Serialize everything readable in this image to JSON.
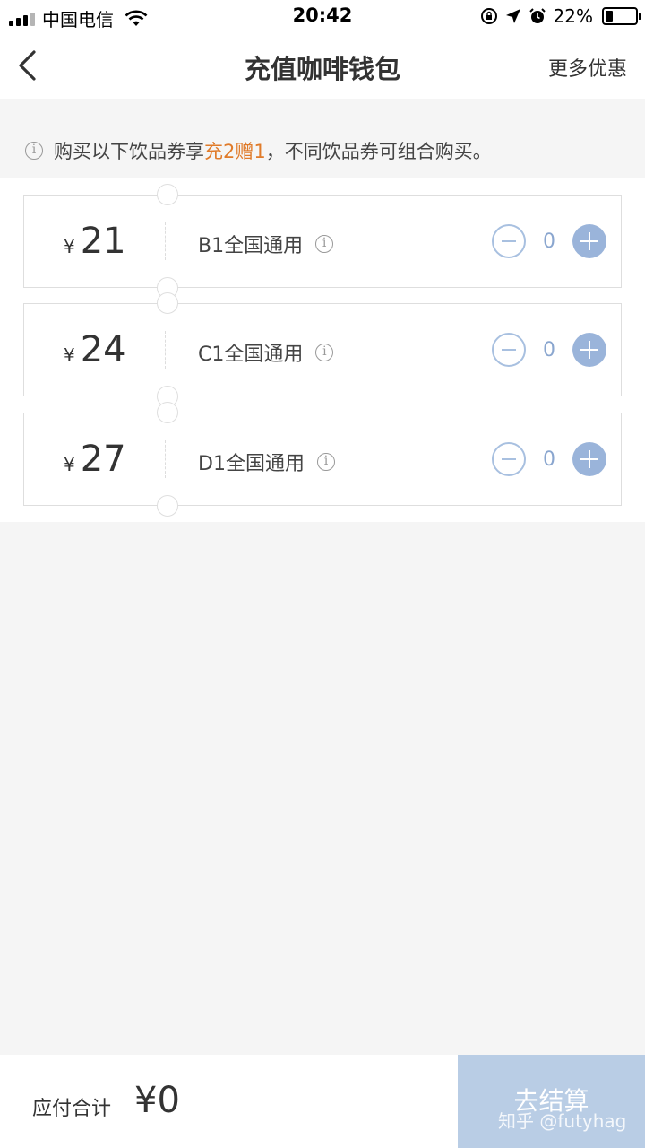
{
  "status_bar": {
    "carrier": "中国电信",
    "time": "20:42",
    "battery": "22%"
  },
  "nav": {
    "title": "充值咖啡钱包",
    "more": "更多优惠"
  },
  "notice": {
    "prefix": "购买以下饮品券享",
    "highlight": "充2赠1",
    "suffix": "，不同饮品券可组合购买。"
  },
  "coupons": [
    {
      "currency": "¥",
      "price": "21",
      "name": "B1全国通用",
      "count": "0"
    },
    {
      "currency": "¥",
      "price": "24",
      "name": "C1全国通用",
      "count": "0"
    },
    {
      "currency": "¥",
      "price": "27",
      "name": "D1全国通用",
      "count": "0"
    }
  ],
  "footer": {
    "total_label": "应付合计",
    "total_amount": "¥0",
    "checkout_label": "去结算"
  },
  "watermark": "知乎 @futyhag",
  "colors": {
    "accent": "#e07b2a",
    "stepper": "#9ab4da",
    "checkout_bg": "#b9cde5"
  }
}
